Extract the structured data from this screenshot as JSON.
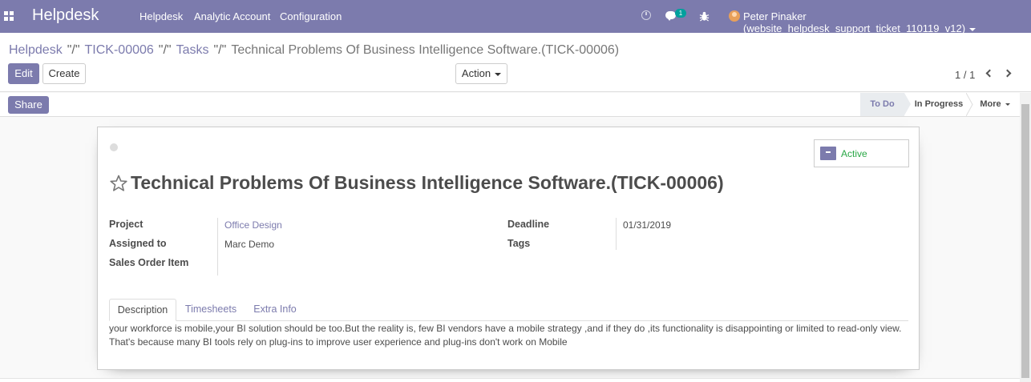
{
  "navbar": {
    "brand": "Helpdesk",
    "menu": [
      "Helpdesk",
      "Analytic Account",
      "Configuration"
    ],
    "chat_badge": "1",
    "user": "Peter Pinaker (website_helpdesk_support_ticket_110119_v12)",
    "color": "#7c7bad"
  },
  "breadcrumb": {
    "items": [
      "Helpdesk",
      "TICK-00006",
      "Tasks"
    ],
    "separator": "\"/\"",
    "current": "Technical Problems Of Business Intelligence Software.(TICK-00006)"
  },
  "toolbar": {
    "edit_label": "Edit",
    "create_label": "Create",
    "action_label": "Action",
    "pager": "1 / 1"
  },
  "statusbar": {
    "share_label": "Share",
    "stages": [
      "To Do",
      "In Progress"
    ],
    "active_stage": "To Do",
    "more_label": "More"
  },
  "sheet": {
    "active_label": "Active",
    "title": "Technical Problems Of Business Intelligence Software.(TICK-00006)",
    "fields": {
      "project_label": "Project",
      "project_value": "Office Design",
      "assigned_label": "Assigned to",
      "assigned_value": "Marc Demo",
      "sales_label": "Sales Order Item",
      "sales_value": "",
      "deadline_label": "Deadline",
      "deadline_value": "01/31/2019",
      "tags_label": "Tags",
      "tags_value": ""
    },
    "tabs": [
      "Description",
      "Timesheets",
      "Extra Info"
    ],
    "active_tab": "Description",
    "description": "your workforce is mobile,your BI solution should be too.But the reality is, few BI vendors have a mobile strategy ,and if they do ,its functionality is disappointing or limited to read-only view. That's because many BI tools rely on plug-ins to improve user experience and plug-ins don't work on Mobile"
  }
}
